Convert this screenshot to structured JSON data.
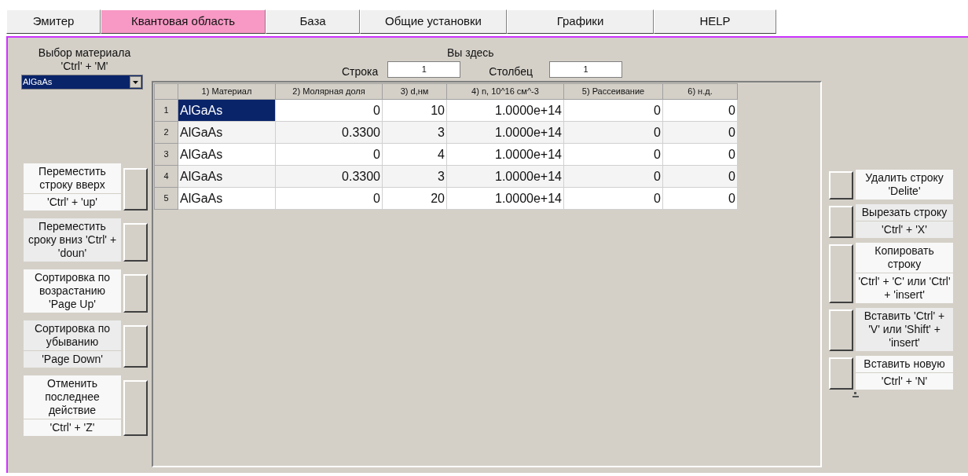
{
  "tabs": [
    {
      "label": "Эмитер",
      "selected": false
    },
    {
      "label": "Квантовая область",
      "selected": true
    },
    {
      "label": "База",
      "selected": false
    },
    {
      "label": "Общие установки",
      "selected": false
    },
    {
      "label": "Графики",
      "selected": false
    },
    {
      "label": "HELP",
      "selected": false
    }
  ],
  "material": {
    "title": "Выбор материала",
    "shortcut": "'Ctrl' + 'M'",
    "value": "AlGaAs"
  },
  "position": {
    "title": "Вы здесь",
    "row_label": "Строка",
    "row_value": "1",
    "column_label": "Столбец",
    "column_value": "1"
  },
  "table": {
    "columns": [
      "1) Материал",
      "2) Молярная доля",
      "3) d,нм",
      "4) n, 10^16 см^-3",
      "5) Рассеивание",
      "6) н.д."
    ],
    "rows": [
      {
        "number": "1",
        "cells": [
          "AlGaAs",
          "0",
          "10",
          "1.0000e+14",
          "0",
          "0"
        ]
      },
      {
        "number": "2",
        "cells": [
          "AlGaAs",
          "0.3300",
          "3",
          "1.0000e+14",
          "0",
          "0"
        ]
      },
      {
        "number": "3",
        "cells": [
          "AlGaAs",
          "0",
          "4",
          "1.0000e+14",
          "0",
          "0"
        ]
      },
      {
        "number": "4",
        "cells": [
          "AlGaAs",
          "0.3300",
          "3",
          "1.0000e+14",
          "0",
          "0"
        ]
      },
      {
        "number": "5",
        "cells": [
          "AlGaAs",
          "0",
          "20",
          "1.0000e+14",
          "0",
          "0"
        ]
      }
    ]
  },
  "left_actions": [
    {
      "label": "Переместить строку вверх",
      "shortcut": "'Ctrl' + 'up'"
    },
    {
      "label": "Переместить сроку вниз 'Ctrl' + 'doun'"
    },
    {
      "label": "Сортировка по возрастанию 'Page Up'"
    },
    {
      "label": "Сортировка по убыванию",
      "shortcut": "'Page Down'"
    },
    {
      "label": "Отменить последнее действие",
      "shortcut": "'Ctrl' + 'Z'"
    }
  ],
  "right_actions": [
    {
      "label": "Удалить строку 'Delite'"
    },
    {
      "label": "Вырезать строку",
      "shortcut": "'Ctrl' + 'X'"
    },
    {
      "label": "Копировать строку",
      "shortcut": "'Ctrl' + 'C' или 'Ctrl' + 'insert'"
    },
    {
      "label": "Вставить 'Ctrl' + 'V' или 'Shift' + 'insert'"
    },
    {
      "label": "Вставить новую",
      "shortcut": "'Ctrl' + 'N'"
    }
  ]
}
